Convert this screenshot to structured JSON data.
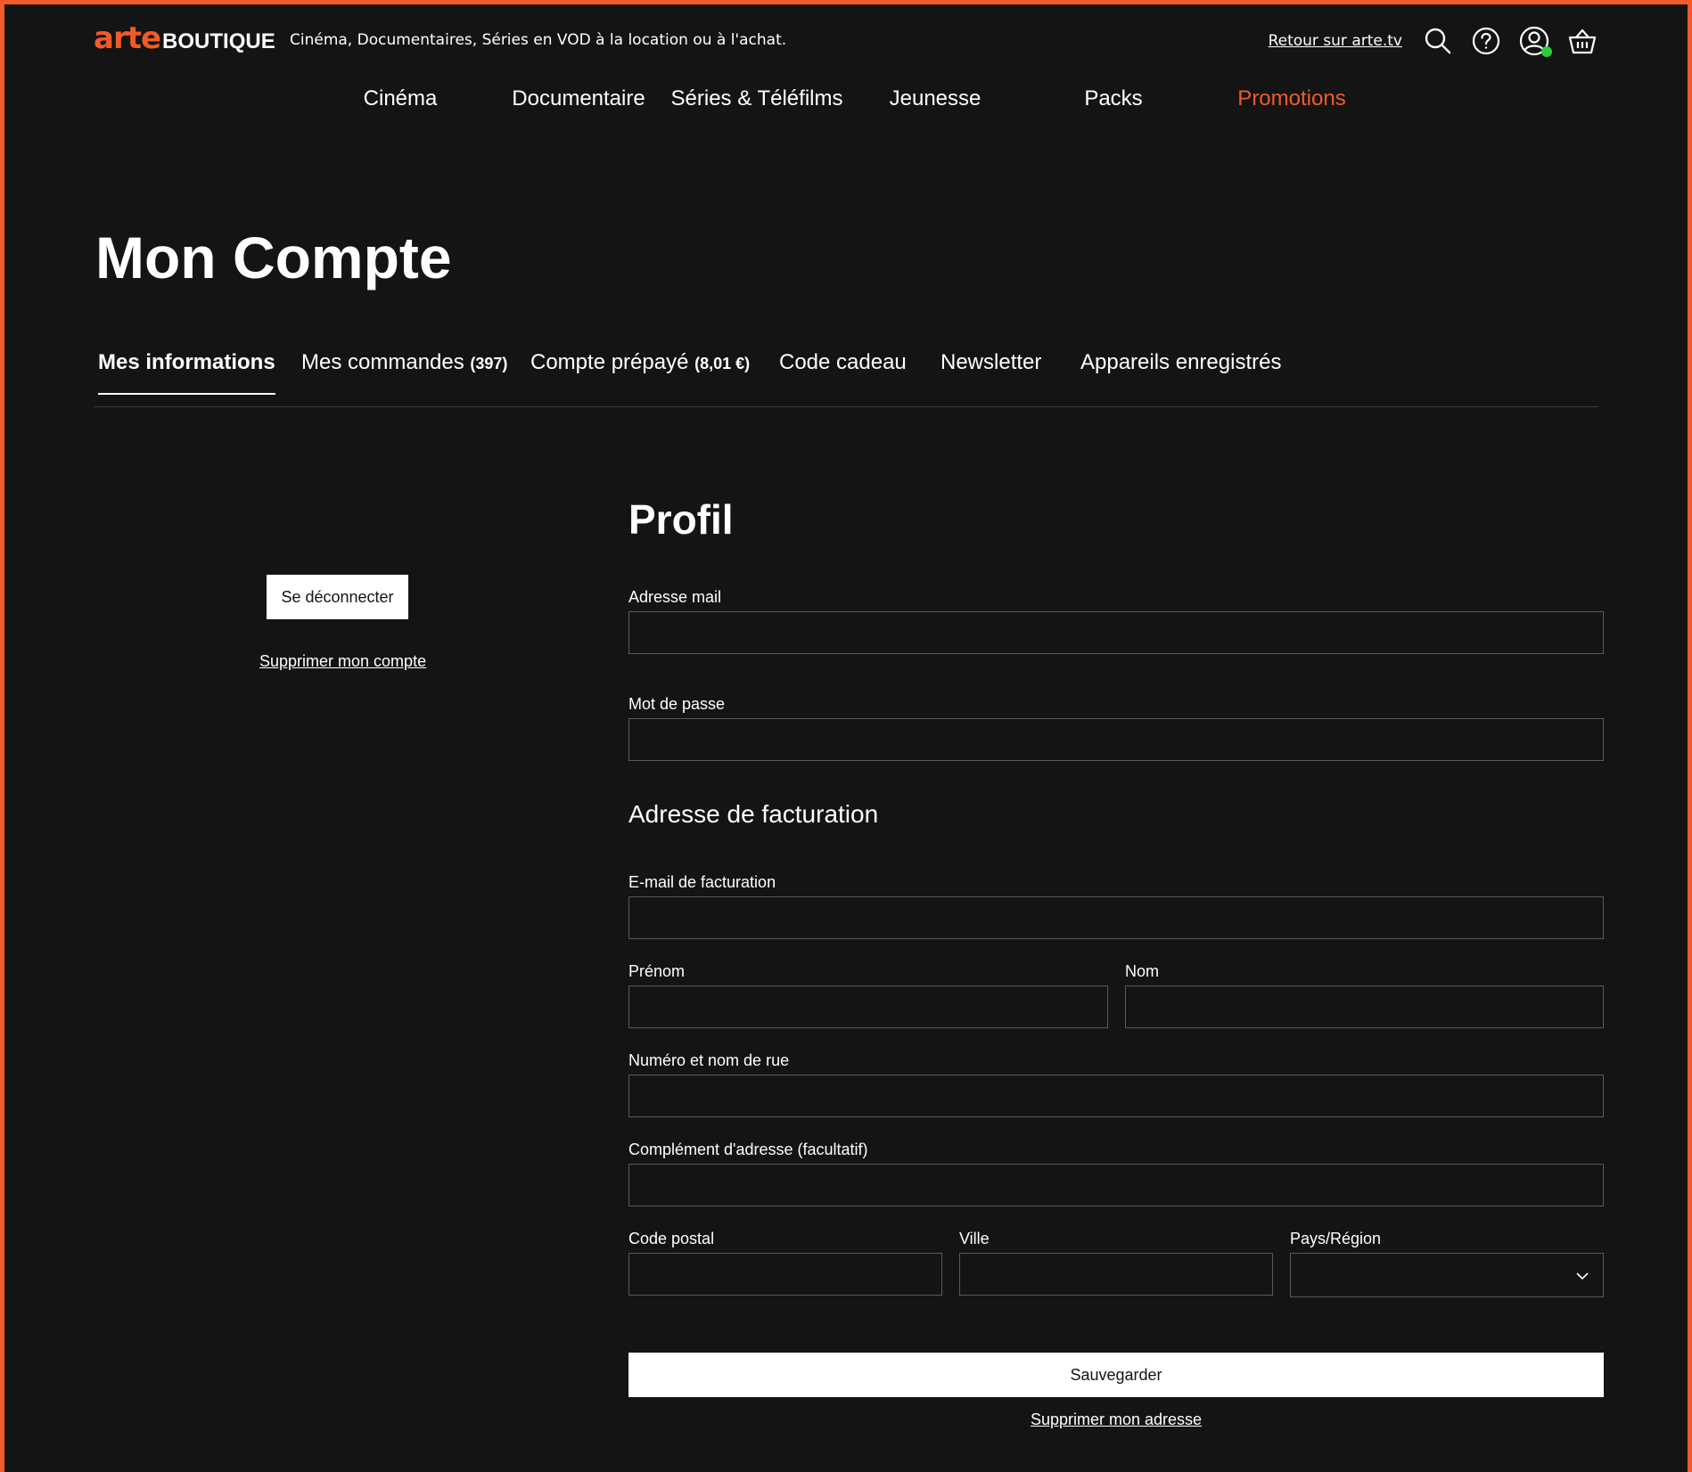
{
  "header": {
    "logo_arte": "arte",
    "logo_boutique": "BOUTIQUE",
    "tagline": "Cinéma, Documentaires, Séries en VOD à la location ou à l'achat.",
    "back_link": "Retour sur arte.tv",
    "icons": [
      "search-icon",
      "help-icon",
      "user-icon",
      "basket-icon"
    ],
    "user_status": "online"
  },
  "nav": {
    "items": [
      {
        "label": "Cinéma"
      },
      {
        "label": "Documentaire"
      },
      {
        "label": "Séries & Téléfilms"
      },
      {
        "label": "Jeunesse"
      },
      {
        "label": "Packs"
      },
      {
        "label": "Promotions",
        "highlight": true
      }
    ]
  },
  "page": {
    "title": "Mon Compte"
  },
  "tabs": [
    {
      "label": "Mes informations",
      "active": true
    },
    {
      "label": "Mes commandes",
      "count": "(397)"
    },
    {
      "label": "Compte prépayé",
      "count": "(8,01 €)"
    },
    {
      "label": "Code cadeau"
    },
    {
      "label": "Newsletter"
    },
    {
      "label": "Appareils enregistrés"
    }
  ],
  "sidebar": {
    "logout_label": "Se déconnecter",
    "delete_account_label": "Supprimer mon compte"
  },
  "profile": {
    "title": "Profil",
    "email_label": "Adresse mail",
    "email_value": "",
    "password_label": "Mot de passe",
    "password_value": ""
  },
  "billing": {
    "title": "Adresse de facturation",
    "email_label": "E-mail de facturation",
    "firstname_label": "Prénom",
    "lastname_label": "Nom",
    "street_label": "Numéro et nom de rue",
    "complement_label": "Complément d'adresse (facultatif)",
    "postal_label": "Code postal",
    "city_label": "Ville",
    "country_label": "Pays/Région",
    "save_label": "Sauvegarder",
    "delete_address_label": "Supprimer mon adresse"
  },
  "colors": {
    "background": "#141414",
    "accent": "#f15a29",
    "text": "#ffffff",
    "field_border": "#5a5a5a",
    "online": "#2ecc40"
  }
}
